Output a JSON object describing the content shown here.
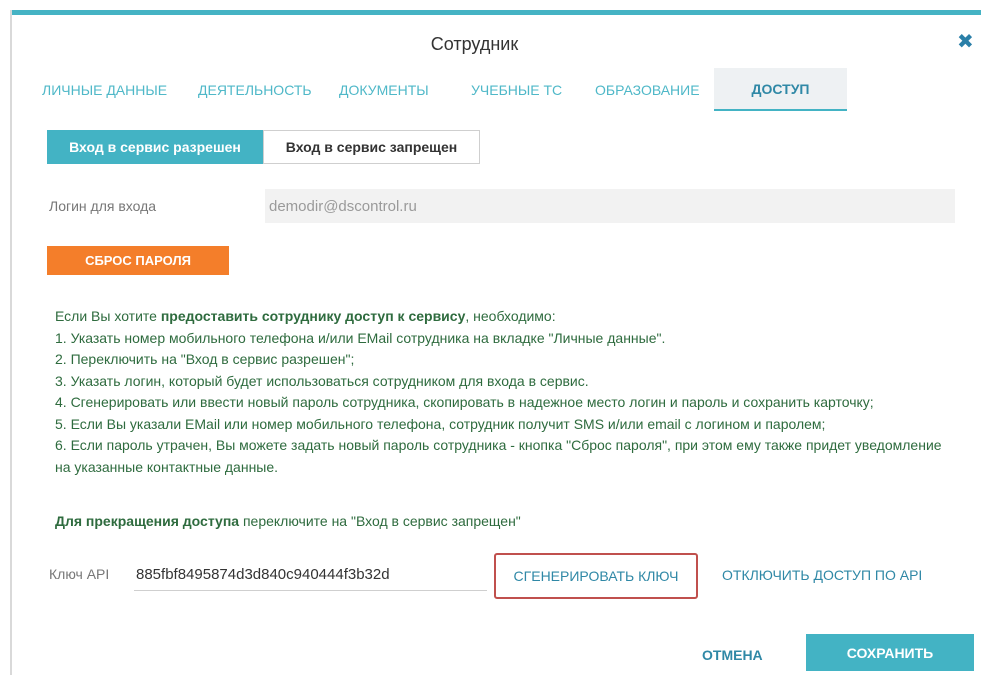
{
  "dialog": {
    "title": "Сотрудник",
    "close_icon": "close-icon"
  },
  "tabs": [
    {
      "label": "ЛИЧНЫЕ ДАННЫЕ"
    },
    {
      "label": "ДЕЯТЕЛЬНОСТЬ"
    },
    {
      "label": "ДОКУМЕНТЫ"
    },
    {
      "label": "УЧЕБНЫЕ ТС"
    },
    {
      "label": "ОБРАЗОВАНИЕ"
    },
    {
      "label": "ДОСТУП",
      "active": true
    }
  ],
  "access_toggle": {
    "allowed_label": "Вход в сервис разрешен",
    "denied_label": "Вход в сервис запрещен",
    "selected": "allowed"
  },
  "login": {
    "label": "Логин для входа",
    "value": "demodir@dscontrol.ru"
  },
  "reset_password_label": "СБРОС ПАРОЛЯ",
  "info": {
    "intro_pre": "Если Вы хотите ",
    "intro_bold": "предоставить сотруднику доступ к сервису",
    "intro_post": ", необходимо:",
    "step1": "1. Указать номер мобильного телефона и/или EMail сотрудника на вкладке \"Личные данные\".",
    "step2": "2. Переключить на \"Вход в сервис разрешен\";",
    "step3": "3. Указать логин, который будет использоваться сотрудником для входа в сервис.",
    "step4": "4. Сгенерировать или ввести новый пароль сотрудника, скопировать в надежное место логин и пароль и сохранить карточку;",
    "step5": "5. Если Вы указали EMail или номер мобильного телефона, сотрудник получит SMS и/или email с логином и паролем;",
    "step6": "6. Если пароль утрачен, Вы можете задать новый пароль сотрудника - кнопка \"Сброс пароля\", при этом ему также придет уведомление на указанные контактные данные."
  },
  "stop_access": {
    "bold": "Для прекращения доступа",
    "rest": " переключите на \"Вход в сервис запрещен\""
  },
  "api": {
    "label": "Ключ API",
    "value": "885fbf8495874d3d840c940444f3b32d",
    "generate_label": "СГЕНЕРИРОВАТЬ КЛЮЧ",
    "disable_label": "ОТКЛЮЧИТЬ ДОСТУП ПО API"
  },
  "footer": {
    "cancel_label": "ОТМЕНА",
    "save_label": "СОХРАНИТЬ"
  },
  "colors": {
    "accent": "#43b3c4",
    "link": "#2f88a6",
    "orange": "#f47e2a",
    "info_text": "#2e6b3e",
    "highlight_border": "#c0504d"
  }
}
